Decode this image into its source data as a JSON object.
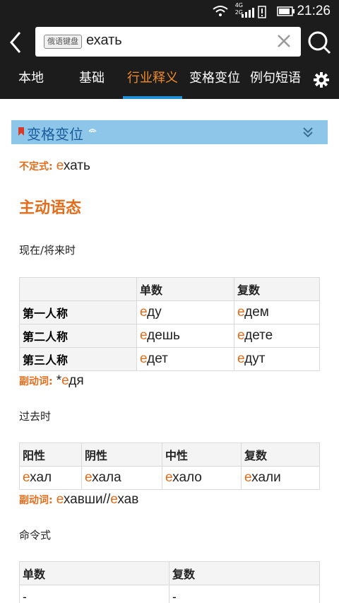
{
  "status_bar": {
    "time": "21:26",
    "net1": "4G",
    "net2": "2G"
  },
  "search": {
    "keyboard_badge": "俄语键盘",
    "query": "ехать"
  },
  "tabs": [
    "本地",
    "基础",
    "行业释义",
    "变格变位",
    "例句短语"
  ],
  "section": {
    "title": "变格变位"
  },
  "infinitive": {
    "label": "不定式:",
    "first": "е",
    "rest": "хать"
  },
  "voice_title": "主动语态",
  "present": {
    "title": "现在/将来时",
    "headers": [
      "",
      "单数",
      "复数"
    ],
    "rows": [
      {
        "person": "第一人称",
        "sg_e": "е",
        "sg": "ду",
        "pl_e": "е",
        "pl": "дем"
      },
      {
        "person": "第二人称",
        "sg_e": "е",
        "sg": "дешь",
        "pl_e": "е",
        "pl": "дете"
      },
      {
        "person": "第三人称",
        "sg_e": "е",
        "sg": "дет",
        "pl_e": "е",
        "pl": "дут"
      }
    ]
  },
  "participle1": {
    "label": "副动词:",
    "prefix": "*",
    "e": "е",
    "rest": "дя"
  },
  "past": {
    "title": "过去时",
    "headers": [
      "阳性",
      "阴性",
      "中性",
      "复数"
    ],
    "cells": [
      {
        "e": "е",
        "rest": "хал"
      },
      {
        "e": "е",
        "rest": "хала"
      },
      {
        "e": "е",
        "rest": "хало"
      },
      {
        "e": "е",
        "rest": "хали"
      }
    ]
  },
  "participle2": {
    "label": "副动词:",
    "e1": "е",
    "rest1": "хавши//",
    "e2": "е",
    "rest2": "хав"
  },
  "imperative": {
    "title": "命令式",
    "headers": [
      "单数",
      "复数"
    ],
    "values": [
      "-",
      "-"
    ]
  },
  "colors": {
    "accent": "#e46c1a",
    "tab_active": "#f08b2c",
    "underline": "#1f90d8",
    "section_bg": "#8ec6ea"
  }
}
